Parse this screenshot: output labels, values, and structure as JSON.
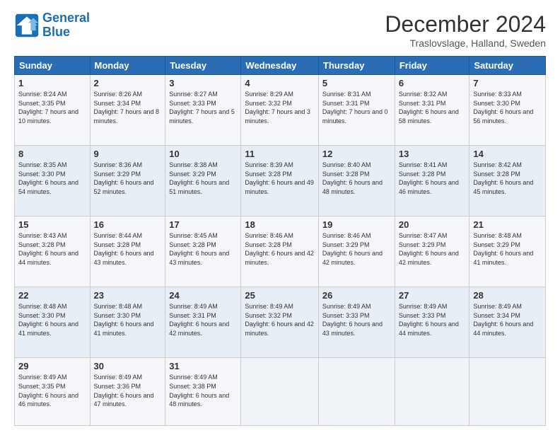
{
  "logo": {
    "line1": "General",
    "line2": "Blue"
  },
  "title": "December 2024",
  "subtitle": "Traslovslage, Halland, Sweden",
  "days_header": [
    "Sunday",
    "Monday",
    "Tuesday",
    "Wednesday",
    "Thursday",
    "Friday",
    "Saturday"
  ],
  "weeks": [
    [
      {
        "day": "1",
        "sunrise": "8:24 AM",
        "sunset": "3:35 PM",
        "daylight": "7 hours and 10 minutes."
      },
      {
        "day": "2",
        "sunrise": "8:26 AM",
        "sunset": "3:34 PM",
        "daylight": "7 hours and 8 minutes."
      },
      {
        "day": "3",
        "sunrise": "8:27 AM",
        "sunset": "3:33 PM",
        "daylight": "7 hours and 5 minutes."
      },
      {
        "day": "4",
        "sunrise": "8:29 AM",
        "sunset": "3:32 PM",
        "daylight": "7 hours and 3 minutes."
      },
      {
        "day": "5",
        "sunrise": "8:31 AM",
        "sunset": "3:31 PM",
        "daylight": "7 hours and 0 minutes."
      },
      {
        "day": "6",
        "sunrise": "8:32 AM",
        "sunset": "3:31 PM",
        "daylight": "6 hours and 58 minutes."
      },
      {
        "day": "7",
        "sunrise": "8:33 AM",
        "sunset": "3:30 PM",
        "daylight": "6 hours and 56 minutes."
      }
    ],
    [
      {
        "day": "8",
        "sunrise": "8:35 AM",
        "sunset": "3:30 PM",
        "daylight": "6 hours and 54 minutes."
      },
      {
        "day": "9",
        "sunrise": "8:36 AM",
        "sunset": "3:29 PM",
        "daylight": "6 hours and 52 minutes."
      },
      {
        "day": "10",
        "sunrise": "8:38 AM",
        "sunset": "3:29 PM",
        "daylight": "6 hours and 51 minutes."
      },
      {
        "day": "11",
        "sunrise": "8:39 AM",
        "sunset": "3:28 PM",
        "daylight": "6 hours and 49 minutes."
      },
      {
        "day": "12",
        "sunrise": "8:40 AM",
        "sunset": "3:28 PM",
        "daylight": "6 hours and 48 minutes."
      },
      {
        "day": "13",
        "sunrise": "8:41 AM",
        "sunset": "3:28 PM",
        "daylight": "6 hours and 46 minutes."
      },
      {
        "day": "14",
        "sunrise": "8:42 AM",
        "sunset": "3:28 PM",
        "daylight": "6 hours and 45 minutes."
      }
    ],
    [
      {
        "day": "15",
        "sunrise": "8:43 AM",
        "sunset": "3:28 PM",
        "daylight": "6 hours and 44 minutes."
      },
      {
        "day": "16",
        "sunrise": "8:44 AM",
        "sunset": "3:28 PM",
        "daylight": "6 hours and 43 minutes."
      },
      {
        "day": "17",
        "sunrise": "8:45 AM",
        "sunset": "3:28 PM",
        "daylight": "6 hours and 43 minutes."
      },
      {
        "day": "18",
        "sunrise": "8:46 AM",
        "sunset": "3:28 PM",
        "daylight": "6 hours and 42 minutes."
      },
      {
        "day": "19",
        "sunrise": "8:46 AM",
        "sunset": "3:29 PM",
        "daylight": "6 hours and 42 minutes."
      },
      {
        "day": "20",
        "sunrise": "8:47 AM",
        "sunset": "3:29 PM",
        "daylight": "6 hours and 42 minutes."
      },
      {
        "day": "21",
        "sunrise": "8:48 AM",
        "sunset": "3:29 PM",
        "daylight": "6 hours and 41 minutes."
      }
    ],
    [
      {
        "day": "22",
        "sunrise": "8:48 AM",
        "sunset": "3:30 PM",
        "daylight": "6 hours and 41 minutes."
      },
      {
        "day": "23",
        "sunrise": "8:48 AM",
        "sunset": "3:30 PM",
        "daylight": "6 hours and 41 minutes."
      },
      {
        "day": "24",
        "sunrise": "8:49 AM",
        "sunset": "3:31 PM",
        "daylight": "6 hours and 42 minutes."
      },
      {
        "day": "25",
        "sunrise": "8:49 AM",
        "sunset": "3:32 PM",
        "daylight": "6 hours and 42 minutes."
      },
      {
        "day": "26",
        "sunrise": "8:49 AM",
        "sunset": "3:33 PM",
        "daylight": "6 hours and 43 minutes."
      },
      {
        "day": "27",
        "sunrise": "8:49 AM",
        "sunset": "3:33 PM",
        "daylight": "6 hours and 44 minutes."
      },
      {
        "day": "28",
        "sunrise": "8:49 AM",
        "sunset": "3:34 PM",
        "daylight": "6 hours and 44 minutes."
      }
    ],
    [
      {
        "day": "29",
        "sunrise": "8:49 AM",
        "sunset": "3:35 PM",
        "daylight": "6 hours and 46 minutes."
      },
      {
        "day": "30",
        "sunrise": "8:49 AM",
        "sunset": "3:36 PM",
        "daylight": "6 hours and 47 minutes."
      },
      {
        "day": "31",
        "sunrise": "8:49 AM",
        "sunset": "3:38 PM",
        "daylight": "6 hours and 48 minutes."
      },
      null,
      null,
      null,
      null
    ]
  ]
}
